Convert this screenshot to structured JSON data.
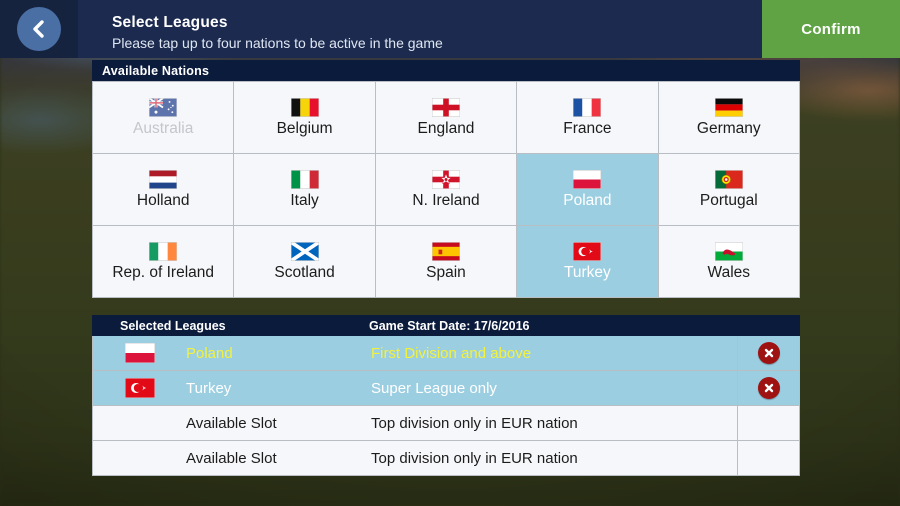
{
  "header": {
    "back_icon": "chevron-left-icon",
    "title": "Select Leagues",
    "subtitle": "Please tap up to four nations to be active in the game",
    "confirm_label": "Confirm",
    "bar_color": "#1b2a4e",
    "confirm_color": "#5fa344",
    "back_circle_color": "#4a6fa5"
  },
  "nations_panel": {
    "header_label": "Available Nations",
    "header_color": "#0b1b3c",
    "selected_tile_color": "#9ccee1",
    "tile_color": "#f6f7fa",
    "nations": [
      {
        "label": "Australia",
        "flag": "flag-australia",
        "selected": false,
        "disabled": true
      },
      {
        "label": "Belgium",
        "flag": "flag-belgium",
        "selected": false,
        "disabled": false
      },
      {
        "label": "England",
        "flag": "flag-england",
        "selected": false,
        "disabled": false
      },
      {
        "label": "France",
        "flag": "flag-france",
        "selected": false,
        "disabled": false
      },
      {
        "label": "Germany",
        "flag": "flag-germany",
        "selected": false,
        "disabled": false
      },
      {
        "label": "Holland",
        "flag": "flag-holland",
        "selected": false,
        "disabled": false
      },
      {
        "label": "Italy",
        "flag": "flag-italy",
        "selected": false,
        "disabled": false
      },
      {
        "label": "N. Ireland",
        "flag": "flag-n-ireland",
        "selected": false,
        "disabled": false
      },
      {
        "label": "Poland",
        "flag": "flag-poland",
        "selected": true,
        "disabled": false
      },
      {
        "label": "Portugal",
        "flag": "flag-portugal",
        "selected": false,
        "disabled": false
      },
      {
        "label": "Rep. of Ireland",
        "flag": "flag-ireland",
        "selected": false,
        "disabled": false
      },
      {
        "label": "Scotland",
        "flag": "flag-scotland",
        "selected": false,
        "disabled": false
      },
      {
        "label": "Spain",
        "flag": "flag-spain",
        "selected": false,
        "disabled": false
      },
      {
        "label": "Turkey",
        "flag": "flag-turkey",
        "selected": true,
        "disabled": false
      },
      {
        "label": "Wales",
        "flag": "flag-wales",
        "selected": false,
        "disabled": false
      }
    ]
  },
  "selected_panel": {
    "header_label": "Selected Leagues",
    "start_date_label": "Game Start Date: 17/6/2016",
    "active_text_color": "#f2f23d",
    "delete_icon": "close-circle-icon",
    "rows": [
      {
        "name": "Poland",
        "description": "First Division and above",
        "flag": "flag-poland",
        "filled": true,
        "active": true,
        "has_delete": true
      },
      {
        "name": "Turkey",
        "description": "Super League only",
        "flag": "flag-turkey",
        "filled": true,
        "active": false,
        "has_delete": true
      },
      {
        "name": "Available Slot",
        "description": "Top division only in EUR nation",
        "flag": null,
        "filled": false,
        "active": false,
        "has_delete": false
      },
      {
        "name": "Available Slot",
        "description": "Top division only in EUR nation",
        "flag": null,
        "filled": false,
        "active": false,
        "has_delete": false
      }
    ]
  }
}
